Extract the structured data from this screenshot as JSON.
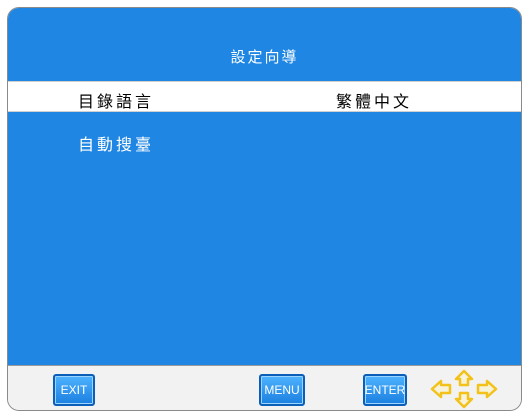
{
  "osd": {
    "title": "設定向導",
    "rows": [
      {
        "label": "目錄語言",
        "value": "繁體中文",
        "selected": true
      },
      {
        "label": "自動搜臺",
        "value": "",
        "selected": false
      }
    ]
  },
  "bottom_bar": {
    "exit_label": "EXIT",
    "menu_label": "MENU",
    "enter_label": "ENTER",
    "nav_icon": "dpad-arrows-icon"
  },
  "colors": {
    "panel_blue": "#1f86e3",
    "key_blue": "#1b7fe0",
    "arrow_yellow": "#f2c21a",
    "arrow_fill": "#f7f2d8"
  }
}
